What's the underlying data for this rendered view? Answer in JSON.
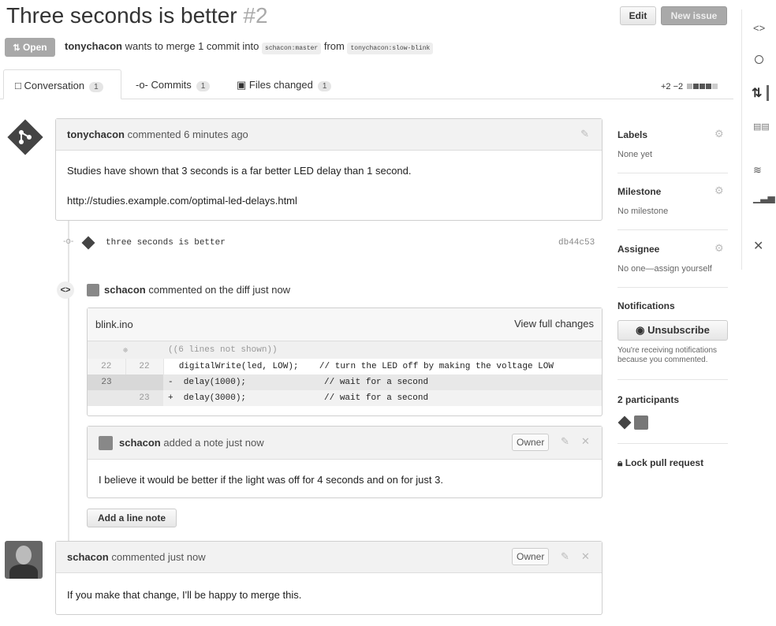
{
  "header": {
    "title": "Three seconds is better",
    "number": "#2",
    "edit_label": "Edit",
    "new_issue_label": "New issue"
  },
  "state": {
    "badge": "Open",
    "author": "tonychacon",
    "text1": "wants to merge 1 commit into",
    "base": "schacon:master",
    "text2": "from",
    "head": "tonychacon:slow-blink"
  },
  "tabs": [
    {
      "label": "Conversation",
      "count": "1"
    },
    {
      "label": "Commits",
      "count": "1"
    },
    {
      "label": "Files changed",
      "count": "1"
    }
  ],
  "diffstat": {
    "added": "+2",
    "removed": "−2"
  },
  "comment1": {
    "author": "tonychacon",
    "meta": "commented 6 minutes ago",
    "body1": "Studies have shown that 3 seconds is a far better LED delay than 1 second.",
    "body2": "http://studies.example.com/optimal-led-delays.html"
  },
  "commit": {
    "message": "three seconds is better",
    "sha": "db44c53"
  },
  "diffcomment": {
    "author": "schacon",
    "meta": "commented on the diff just now",
    "file": "blink.ino",
    "view_full": "View full changes",
    "hidden": "((6 lines not shown))",
    "lines": [
      {
        "old": "22",
        "new": "22",
        "code": "  digitalWrite(led, LOW);    // turn the LED off by making the voltage LOW"
      },
      {
        "old": "23",
        "new": "",
        "code": "-  delay(1000);               // wait for a second"
      },
      {
        "old": "",
        "new": "23",
        "code": "+  delay(3000);               // wait for a second"
      }
    ],
    "note_author": "schacon",
    "note_meta": "added a note just now",
    "owner": "Owner",
    "note_body": "I believe it would be better if the light was off for 4 seconds and on for just 3.",
    "add_note": "Add a line note"
  },
  "comment3": {
    "author": "schacon",
    "meta": "commented just now",
    "owner": "Owner",
    "body": "If you make that change, I'll be happy to merge this."
  },
  "sidebar": {
    "labels_h": "Labels",
    "labels_v": "None yet",
    "milestone_h": "Milestone",
    "milestone_v": "No milestone",
    "assignee_h": "Assignee",
    "assignee_v": "No one—assign yourself",
    "notif_h": "Notifications",
    "unsubscribe": "Unsubscribe",
    "notif_t1": "You're receiving notifications",
    "notif_t2": "because you commented.",
    "participants": "2 participants",
    "lock": "Lock pull request"
  },
  "colors": {
    "open_badge": "#a8a8a8",
    "new_issue": "#a9a9a9"
  },
  "icons": [
    "code-icon",
    "issue-icon",
    "pull-request-icon",
    "wiki-icon",
    "pulse-icon",
    "graphs-icon",
    "settings-icon"
  ]
}
